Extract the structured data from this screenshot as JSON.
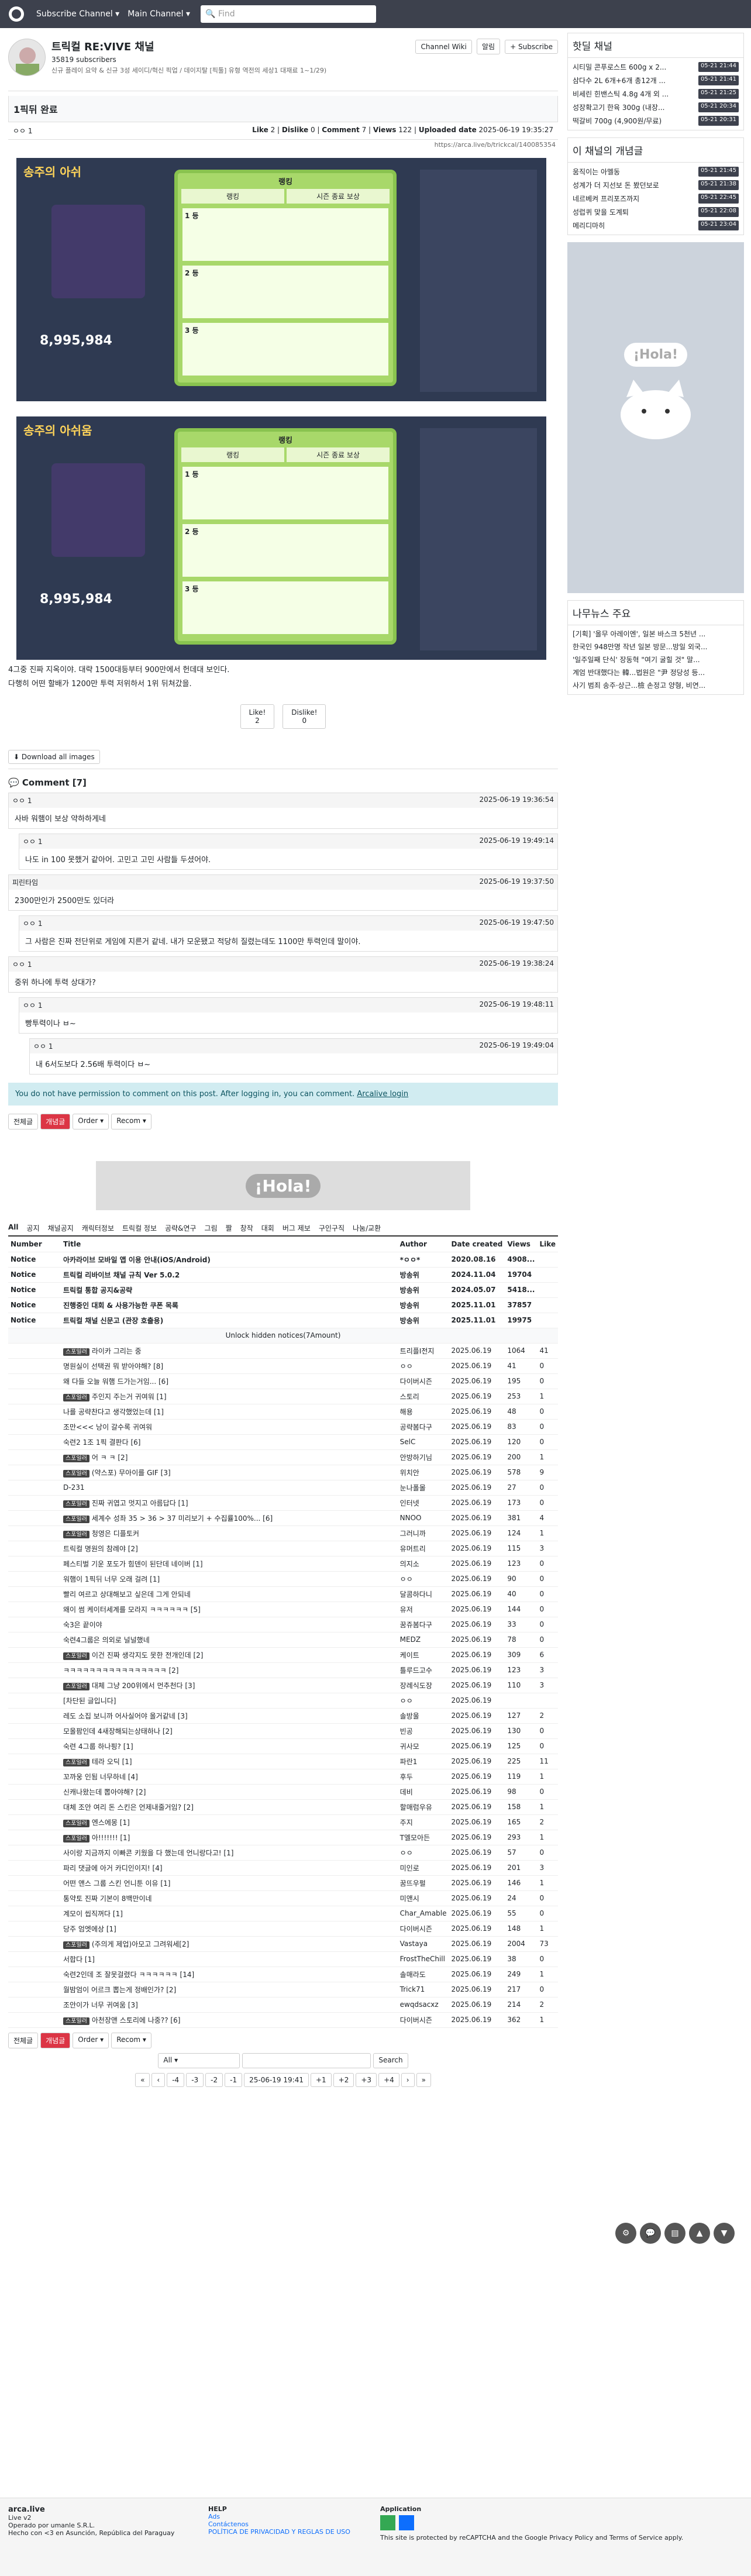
{
  "nav": {
    "menu1": "Subscribe Channel",
    "menu2": "Main Channel",
    "search_placeholder": "Find"
  },
  "channel": {
    "name": "트릭컬 RE:VIVE 채널",
    "subscribers": "35819 subscribers",
    "desc": "신규 플레이 요약 & 신규 3성 세이디/혁신 픽업 / 데이지탈 [픽툴] 유형 역전의 세상1 대재료 1~1/29)",
    "wiki": "Channel Wiki",
    "notice": "알림",
    "subscribe": "+ Subscribe"
  },
  "post": {
    "title": "1픽뒤 완료",
    "author": "ㅇㅇ 1",
    "like_label": "Like",
    "like": "2",
    "dislike_label": "Dislike",
    "dislike": "0",
    "comment_label": "Comment",
    "comment": "7",
    "views_label": "Views",
    "views": "122",
    "uploaded_label": "Uploaded date",
    "uploaded": "2025-06-19 19:35:27",
    "url": "https://arca.live/b/trickcal/140085354",
    "body1": "4그중 진짜 지옥이야. 대략 1500대등부터 900만에서 헌데대 보인다.",
    "body2": "다행히 어떤 할배가 1200만 투력 저위하서 1위 뒤쳐갔을.",
    "like_btn": "Like!",
    "like_count": "2",
    "dislike_btn": "Dislike!",
    "dislike_count": "0",
    "download": "Download all images",
    "game1": {
      "title": "송주의 아쉬",
      "panel_title": "랭킹",
      "tab1": "랭킹",
      "tab2": "시즌 종료 보상",
      "r1": "1 등",
      "r2": "2 등",
      "r3": "3 등",
      "score": "8,995,984"
    },
    "game2": {
      "title": "송주의 아쉬움",
      "panel_title": "랭킹",
      "tab1": "랭킹",
      "tab2": "시즌 종료 보상",
      "r1": "1 등",
      "r2": "2 등",
      "r3": "3 등",
      "score": "8,995,984"
    }
  },
  "comments": {
    "header": "Comment [7]",
    "no_perm": "You do not have permission to comment on this post. After logging in, you can comment.",
    "login": "Arcalive login",
    "items": [
      {
        "user": "ㅇㅇ 1",
        "time": "2025-06-19 19:36:54",
        "text": "사바 워햄이 보상 약하하게네"
      },
      {
        "user": "ㅇㅇ 1",
        "time": "2025-06-19 19:49:14",
        "text": "나도 in 100 못했거 같아어. 고민고 고민 사람들 두셨어야."
      },
      {
        "user": "피린타임",
        "time": "2025-06-19 19:37:50",
        "text": "2300만인가 2500만도 있더라"
      },
      {
        "user": "ㅇㅇ 1",
        "time": "2025-06-19 19:47:50",
        "text": "그 사람은 진짜 전단위로 게임에 지른거 같네. 내가 모운됐고 적당히 질렸는데도 1100만 투력인데 말이야."
      },
      {
        "user": "ㅇㅇ 1",
        "time": "2025-06-19 19:38:24",
        "text": "중위 하나에 투력 상대가?"
      },
      {
        "user": "ㅇㅇ 1",
        "time": "2025-06-19 19:48:11",
        "text": "빵투력이나 ㅂ~"
      },
      {
        "user": "ㅇㅇ 1",
        "time": "2025-06-19 19:49:04",
        "text": "내 6서도보다 2.56배 투력이다 ㅂ~"
      }
    ]
  },
  "list": {
    "all": "전체글",
    "best": "개념글",
    "order": "Order",
    "recom": "Recom",
    "tabs": [
      "All",
      "공지",
      "채널공지",
      "캐릭터정보",
      "트릭컬 정보",
      "공략&연구",
      "그림",
      "짤",
      "창작",
      "대회",
      "버그 제보",
      "구인구직",
      "나눔/교환"
    ],
    "head": {
      "num": "Number",
      "title": "Title",
      "author": "Author",
      "date": "Date created",
      "views": "Views",
      "like": "Like"
    },
    "notices": [
      {
        "n": "Notice",
        "t": "아카라이브 모바일 앱 이용 안내(iOS/Android)",
        "a": "*ㅇㅇ*",
        "d": "2020.08.16",
        "v": "4908..."
      },
      {
        "n": "Notice",
        "t": "트릭컬 리바이브 채널 규칙 Ver 5.0.2",
        "a": "방송위",
        "d": "2024.11.04",
        "v": "19704"
      },
      {
        "n": "Notice",
        "t": "트릭컬 통합 공지&공략",
        "a": "방송위",
        "d": "2024.05.07",
        "v": "5418..."
      },
      {
        "n": "Notice",
        "t": "진행중인 대회 & 사용가능한 쿠폰 목록",
        "a": "방송위",
        "d": "2025.11.01",
        "v": "37857"
      },
      {
        "n": "Notice",
        "t": "트릭컬 채널 신문고 (관장 호출용)",
        "a": "방송위",
        "d": "2025.11.01",
        "v": "19975"
      }
    ],
    "unlock": "Unlock hidden notices(7Amount)",
    "rows": [
      {
        "c": "스포일러",
        "t": "라이카 그리는 중",
        "a": "트리플I전지",
        "d": "2025.06.19",
        "v": "1064",
        "l": "41"
      },
      {
        "c": "",
        "t": "명원실이 선택권 뭐 받아야해? [8]",
        "a": "ㅇㅇ",
        "d": "2025.06.19",
        "v": "41",
        "l": "0"
      },
      {
        "c": "",
        "t": "왜 다들 오늘 워햄 드가는거임... [6]",
        "a": "다이버시즌",
        "d": "2025.06.19",
        "v": "195",
        "l": "0"
      },
      {
        "c": "스포일러",
        "t": "주인지 주는거 귀여워 [1]",
        "a": "스토리",
        "d": "2025.06.19",
        "v": "253",
        "l": "1"
      },
      {
        "c": "",
        "t": "나를 공략찬다고 생각했었는데 [1]",
        "a": "해용",
        "d": "2025.06.19",
        "v": "48",
        "l": "0"
      },
      {
        "c": "",
        "t": "조만<<< 낭이 갈수록 귀여워",
        "a": "공략봄다구",
        "d": "2025.06.19",
        "v": "83",
        "l": "0"
      },
      {
        "c": "",
        "t": "숙련2 1조 1픽 결판다 [6]",
        "a": "SelC",
        "d": "2025.06.19",
        "v": "120",
        "l": "0"
      },
      {
        "c": "스포일러",
        "t": "어 ㅋ ㅋ [2]",
        "a": "안방하기님",
        "d": "2025.06.19",
        "v": "200",
        "l": "1"
      },
      {
        "c": "스포일러",
        "t": "(약스포) 무아이를 GIF [3]",
        "a": "위치안",
        "d": "2025.06.19",
        "v": "578",
        "l": "9"
      },
      {
        "c": "",
        "t": "D-231",
        "a": "눈나폴몰",
        "d": "2025.06.19",
        "v": "27",
        "l": "0"
      },
      {
        "c": "스포일러",
        "t": "진짜 귀엽고 멋지고 아름답다 [1]",
        "a": "인터넷",
        "d": "2025.06.19",
        "v": "173",
        "l": "0"
      },
      {
        "c": "스포일러",
        "t": "세계수 성좌 35 > 36 > 37 미리보기 + 수집률100%... [6]",
        "a": "NNOO",
        "d": "2025.06.19",
        "v": "381",
        "l": "4"
      },
      {
        "c": "스포일러",
        "t": "청영은 디플토커",
        "a": "그러니까",
        "d": "2025.06.19",
        "v": "124",
        "l": "1"
      },
      {
        "c": "",
        "t": "트릭컬 명원의 참례야 [2]",
        "a": "유머트리",
        "d": "2025.06.19",
        "v": "115",
        "l": "3"
      },
      {
        "c": "",
        "t": "페스티벌 기운 포도가 힘덴이 된단데 네이버 [1]",
        "a": "의지소",
        "d": "2025.06.19",
        "v": "123",
        "l": "0"
      },
      {
        "c": "",
        "t": "워햄이 1픽뒤 너무 오래 걸려 [1]",
        "a": "ㅇㅇ",
        "d": "2025.06.19",
        "v": "90",
        "l": "0"
      },
      {
        "c": "",
        "t": "빨리 여르고 상대해보고 싶은데 그게 안되네",
        "a": "달콤하다니",
        "d": "2025.06.19",
        "v": "40",
        "l": "0"
      },
      {
        "c": "",
        "t": "왜이 썸 케이터세계를 모라지 ㅋㅋㅋㅋㅋㅋ [5]",
        "a": "유저",
        "d": "2025.06.19",
        "v": "144",
        "l": "0"
      },
      {
        "c": "",
        "t": "숙3은 끝이야",
        "a": "꿈쥬봄다구",
        "d": "2025.06.19",
        "v": "33",
        "l": "0"
      },
      {
        "c": "",
        "t": "숙련4그룹은 의외로 널널했네",
        "a": "MEDZ",
        "d": "2025.06.19",
        "v": "78",
        "l": "0"
      },
      {
        "c": "스포일러",
        "t": "이건 진짜 생각지도 못한 전개인데 [2]",
        "a": "케이트",
        "d": "2025.06.19",
        "v": "309",
        "l": "6"
      },
      {
        "c": "",
        "t": "ㅋㅋㅋㅋㅋㅋㅋㅋㅋㅋㅋㅋㅋㅋㅋㅋ [2]",
        "a": "틀루드고수",
        "d": "2025.06.19",
        "v": "123",
        "l": "3"
      },
      {
        "c": "스포일러",
        "t": "대체 그냥 200위에서 먼추천다 [3]",
        "a": "장례식도장",
        "d": "2025.06.19",
        "v": "110",
        "l": "3"
      },
      {
        "c": "",
        "t": "[차단된 글입니다]",
        "a": "ㅇㅇ",
        "d": "2025.06.19",
        "v": "",
        "l": ""
      },
      {
        "c": "",
        "t": "레도 소집 보니까 어사실어야 올거같네 [3]",
        "a": "솔방울",
        "d": "2025.06.19",
        "v": "127",
        "l": "2"
      },
      {
        "c": "",
        "t": "모올팜인데 4새장해되는상태하나 [2]",
        "a": "빈공",
        "d": "2025.06.19",
        "v": "130",
        "l": "0"
      },
      {
        "c": "",
        "t": "숙련 4그룹 하나핑? [1]",
        "a": "귀사모",
        "d": "2025.06.19",
        "v": "125",
        "l": "0"
      },
      {
        "c": "스포일러",
        "t": "테라 오딕 [1]",
        "a": "파란1",
        "d": "2025.06.19",
        "v": "225",
        "l": "11"
      },
      {
        "c": "",
        "t": "꼬까웅 인됨 너무하네 [4]",
        "a": "후두",
        "d": "2025.06.19",
        "v": "119",
        "l": "1"
      },
      {
        "c": "",
        "t": "신캐나왔는데 뽑아야해? [2]",
        "a": "데비",
        "d": "2025.06.19",
        "v": "98",
        "l": "0"
      },
      {
        "c": "",
        "t": "대체 조안 여리 돈 스킨은 언제내줄거임? [2]",
        "a": "할매럼우유",
        "d": "2025.06.19",
        "v": "158",
        "l": "1"
      },
      {
        "c": "스포일러",
        "t": "엔스에몽 [1]",
        "a": "주지",
        "d": "2025.06.19",
        "v": "165",
        "l": "2"
      },
      {
        "c": "스포일러",
        "t": "아!!!!!!! [1]",
        "a": "T엘모아든",
        "d": "2025.06.19",
        "v": "293",
        "l": "1"
      },
      {
        "c": "",
        "t": "사이랑 지금까지 이빠콘 키웠을 다 했는데 언니랑다고! [1]",
        "a": "ㅇㅇ",
        "d": "2025.06.19",
        "v": "57",
        "l": "0"
      },
      {
        "c": "",
        "t": "파리 댓글에 아거 카디인이지! [4]",
        "a": "미인로",
        "d": "2025.06.19",
        "v": "201",
        "l": "3"
      },
      {
        "c": "",
        "t": "어떤 앤스 그룹 스킨 언니툰 이유 [1]",
        "a": "꿈뜨우펄",
        "d": "2025.06.19",
        "v": "146",
        "l": "1"
      },
      {
        "c": "",
        "t": "통약토 진짜 기본이 8백만이네",
        "a": "미앤시",
        "d": "2025.06.19",
        "v": "24",
        "l": "0"
      },
      {
        "c": "",
        "t": "계모이 씹직꺼다 [1]",
        "a": "Char_Amable",
        "d": "2025.06.19",
        "v": "55",
        "l": "0"
      },
      {
        "c": "",
        "t": "당주 엄엣에상 [1]",
        "a": "다이버시즌",
        "d": "2025.06.19",
        "v": "148",
        "l": "1"
      },
      {
        "c": "스포일러",
        "t": "(주의게 제업)아모고 그려워세[2]",
        "a": "Vastaya",
        "d": "2025.06.19",
        "v": "2004",
        "l": "73"
      },
      {
        "c": "",
        "t": "서합다 [1]",
        "a": "FrostTheChill",
        "d": "2025.06.19",
        "v": "38",
        "l": "0"
      },
      {
        "c": "",
        "t": "숙련2인데 조 잘못걸렸다 ㅋㅋㅋㅋㅋㅋ [14]",
        "a": "솔매라도",
        "d": "2025.06.19",
        "v": "249",
        "l": "1"
      },
      {
        "c": "",
        "t": "월밤엄이 어르크 뽑는게 정배인가? [2]",
        "a": "Trick71",
        "d": "2025.06.19",
        "v": "217",
        "l": "0"
      },
      {
        "c": "",
        "t": "조안이가 너무 귀여움 [3]",
        "a": "ewqdsacxz",
        "d": "2025.06.19",
        "v": "214",
        "l": "2"
      },
      {
        "c": "스포일러",
        "t": "아천장앤 스토리에 나중?? [6]",
        "a": "다이버시즌",
        "d": "2025.06.19",
        "v": "362",
        "l": "1"
      }
    ],
    "filter": "All",
    "search": "Search",
    "pages": [
      "«",
      "‹",
      "-4",
      "-3",
      "-2",
      "-1",
      "25-06-19 19:41",
      "+1",
      "+2",
      "+3",
      "+4",
      "›",
      "»"
    ]
  },
  "sidebar": {
    "hot_title": "핫딜 채널",
    "hot": [
      {
        "t": "시티밀 콘푸로스트 600g x 2...",
        "m": "05-21 21:44"
      },
      {
        "t": "삼다수 2L 6개+6개 총12개 ...",
        "m": "05-21 21:41"
      },
      {
        "t": "비세린 힌밴스틱 4.8g 4개 외 ...",
        "m": "05-21 21:25"
      },
      {
        "t": "성장확고기 한육 300g (내장...",
        "m": "05-21 20:34"
      },
      {
        "t": "떡갈비 700g (4,900원/무료)",
        "m": "05-21 20:31"
      }
    ],
    "best_title": "이 채널의 개념글",
    "best": [
      {
        "t": "움직이는 아멜동",
        "m": "05-21 21:45"
      },
      {
        "t": "성계가 더 지선보 돈 봤던보로",
        "m": "05-21 21:38"
      },
      {
        "t": "네르베켜 프리포즈까지",
        "m": "05-21 22:45"
      },
      {
        "t": "성럽퀴 맞을 도계퇴",
        "m": "05-21 22:08"
      },
      {
        "t": "메리디마히",
        "m": "05-21 23:04"
      }
    ],
    "hola": "¡Hola!",
    "news_title": "나무뉴스 주요",
    "news": [
      "[기획] '올무 아레이엔', 일본 바스크 5천년 ...",
      "한국인 948만명 작년 일본 방문...방일 외국...",
      "'일주일째 단식' 장동혁 \"여기 굴힐 것\" 말...",
      "계엄 반대했다는 韓...법원은 \"尹 정당성 등...",
      "사기 범죄 송주·상근...檢 손정고 양형, 비연..."
    ]
  },
  "footer": {
    "brand": "arca.live",
    "ver": "Live v2",
    "op": "Operado por umanle S.R.L.",
    "made": "Hecho con <3 en Asunción, República del Paraguay",
    "help_t": "HELP",
    "help": [
      "Ads",
      "Contáctenos",
      "POLÍTICA DE PRIVACIDAD Y REGLAS DE USO"
    ],
    "app_t": "Application",
    "recap": "This site is protected by reCAPTCHA and the Google Privacy Policy and Terms of Service apply."
  }
}
